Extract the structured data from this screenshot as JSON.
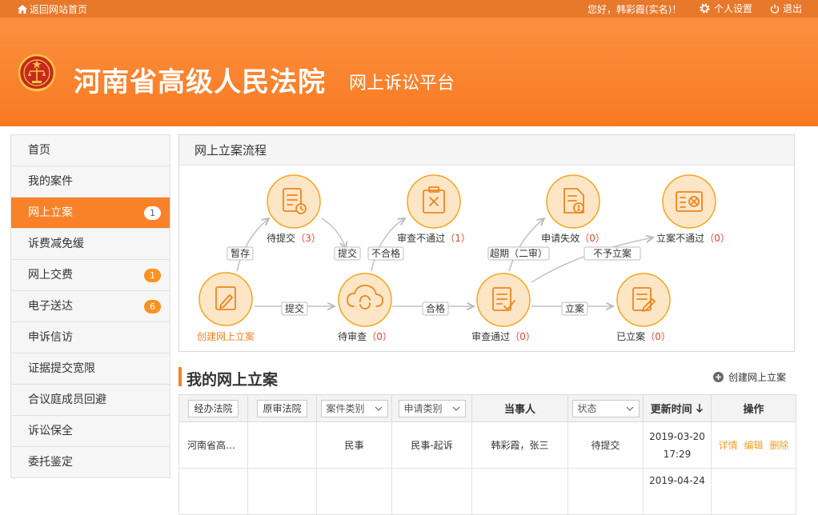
{
  "topbar": {
    "home_label": "返回网站首页",
    "greeting": "您好，韩彩霞(实名)！",
    "settings_label": "个人设置",
    "logout_label": "退出"
  },
  "header": {
    "title": "河南省高级人民法院",
    "subtitle": "网上诉讼平台"
  },
  "sidebar": {
    "items": [
      {
        "label": "首页",
        "badge": ""
      },
      {
        "label": "我的案件",
        "badge": ""
      },
      {
        "label": "网上立案",
        "badge": "1",
        "active": true
      },
      {
        "label": "诉费减免缓",
        "badge": ""
      },
      {
        "label": "网上交费",
        "badge": "1"
      },
      {
        "label": "电子送达",
        "badge": "6"
      },
      {
        "label": "申诉信访",
        "badge": ""
      },
      {
        "label": "证据提交宽限",
        "badge": ""
      },
      {
        "label": "合议庭成员回避",
        "badge": ""
      },
      {
        "label": "诉讼保全",
        "badge": ""
      },
      {
        "label": "委托鉴定",
        "badge": ""
      }
    ]
  },
  "process": {
    "title": "网上立案流程",
    "nodes": {
      "create": {
        "label": "创建网上立案"
      },
      "pending_submit": {
        "label": "待提交",
        "count": "（3）"
      },
      "pending_review": {
        "label": "待审查",
        "count": "（0）"
      },
      "review_rejected": {
        "label": "审查不通过",
        "count": "（1）"
      },
      "review_passed": {
        "label": "审查通过",
        "count": "（0）"
      },
      "apply_invalid": {
        "label": "申请失效",
        "count": "（0）"
      },
      "filing_rejected": {
        "label": "立案不通过",
        "count": "（0）"
      },
      "filed": {
        "label": "已立案",
        "count": "（0）"
      }
    },
    "edges": {
      "save_draft": "暂存",
      "submit_1": "提交",
      "submit_2": "提交",
      "unqualified": "不合格",
      "qualified": "合格",
      "overdue": "超期（二审）",
      "not_filed": "不予立案",
      "file": "立案"
    }
  },
  "my_cases": {
    "title": "我的网上立案",
    "create_label": "创建网上立案",
    "columns": {
      "court": "经办法院",
      "orig_court": "原审法院",
      "case_type": "案件类别",
      "apply_type": "申请类别",
      "parties": "当事人",
      "status": "状态",
      "updated": "更新时间",
      "ops": "操作"
    },
    "rows": [
      {
        "court": "河南省高…",
        "orig_court": "",
        "case_type": "民事",
        "apply_type": "民事-起诉",
        "parties": "韩彩霞，张三",
        "status": "待提交",
        "date": "2019-03-20",
        "time": "17:29",
        "ops": [
          "详情",
          "编辑",
          "删除"
        ]
      },
      {
        "date": "2019-04-24"
      }
    ]
  },
  "colors": {
    "accent": "#f98128",
    "header_top": "#fb8f3f",
    "header_bottom": "#f97a22",
    "node_fill": "#fde6c5",
    "node_stroke": "#f5a623",
    "count_red": "#e0452f"
  }
}
